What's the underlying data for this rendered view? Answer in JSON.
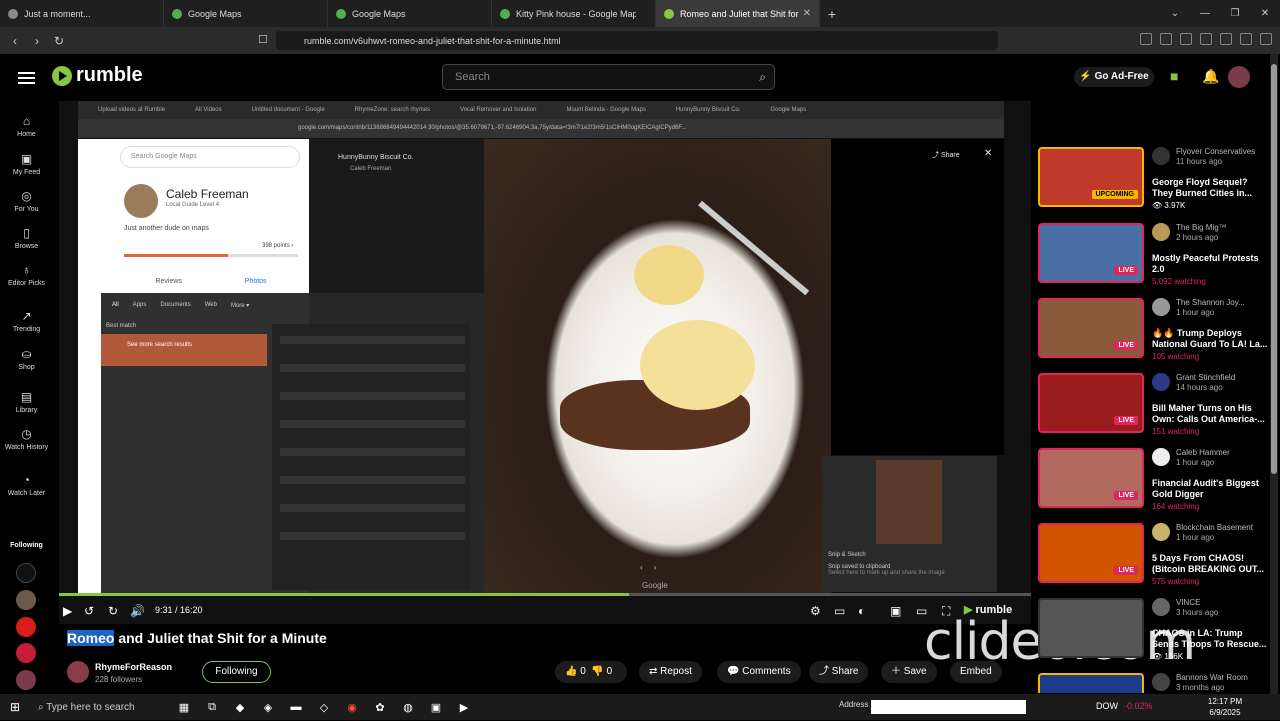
{
  "browser": {
    "tabs": [
      {
        "label": "Just a moment...",
        "color": "#888"
      },
      {
        "label": "Google Maps",
        "color": "#4caf50"
      },
      {
        "label": "Google Maps",
        "color": "#4caf50"
      },
      {
        "label": "Kitty Pink house - Google Maps",
        "color": "#4caf50"
      },
      {
        "label": "Romeo and Juliet that Shit for a",
        "color": "#85c742"
      }
    ],
    "url": "rumble.com/v6uhwvt-romeo-and-juliet-that-shit-for-a-minute.html"
  },
  "header": {
    "logo": "rumble",
    "search_placeholder": "Search",
    "go_ad_free": "Go Ad-Free"
  },
  "sidebar": {
    "items": [
      "Home",
      "My Feed",
      "For You",
      "Browse",
      "Editor Picks",
      "Trending",
      "Shop",
      "Library",
      "Watch History",
      "Watch Later"
    ],
    "following_label": "Following"
  },
  "video_frame": {
    "tabs": [
      "Upload videos at Rumble",
      "All Videos",
      "Untitled document - Google",
      "RhymeZone: search rhymes",
      "Vocal Remover and Isolation",
      "Mount Belinda - Google Maps",
      "HunnyBunny Biscuit Co.",
      "Google Maps"
    ],
    "url": "google.com/maps/contrib/113886849494442014 30/photos/@35.6079671,-97.6246904,3a,75y/data=!3m7!1e2!3m5!1sCIHM0ogKEICAgICPyd6F...",
    "maps_search": "Search Google Maps",
    "profile_name": "Caleb Freeman",
    "profile_sub": "Local Guide Level 4",
    "bio": "Just another dude on maps",
    "points": "398 points ›",
    "tab_reviews": "Reviews",
    "tab_photos": "Photos",
    "place_title": "HunnyBunny Biscuit Co.",
    "place_sub": "Caleb Freeman",
    "share": "Share",
    "winsearch_tabs": [
      "All",
      "Apps",
      "Documents",
      "Web",
      "More ▾"
    ],
    "best_match": "Best match",
    "see_more": "See more search results",
    "snip_title": "Snip & Sketch",
    "snip_msg": "Snip saved to clipboard",
    "snip_sub": "Select here to mark up and share the image",
    "google": "Google"
  },
  "player": {
    "time": "9:31 / 16:20",
    "progress": 0.586,
    "brand": "rumble"
  },
  "video": {
    "title_highlight": "Romeo",
    "title_rest": " and Juliet that Shit for a Minute",
    "channel": "RhymeForReason",
    "followers": "228 followers",
    "follow_btn": "Following",
    "likes": "0",
    "dislikes": "0",
    "repost": "Repost",
    "comments": "Comments",
    "share": "Share",
    "save": "Save",
    "embed": "Embed"
  },
  "watermark": "clideo.com",
  "related": [
    {
      "channel": "Flyover Conservatives",
      "ago": "11 hours ago",
      "title": "George Floyd Sequel? They Burned Cities in...",
      "meta": "3.97K",
      "live": false,
      "badge": "UPCOMING",
      "thumb": "#c0392b"
    },
    {
      "channel": "The Big Mig™",
      "ago": "2 hours ago",
      "title": "Mostly Peaceful Protests 2.0",
      "meta": "5,092 watching",
      "live": true,
      "badge": "LIVE",
      "thumb": "#4a6fa5"
    },
    {
      "channel": "The Shannon Joy...",
      "ago": "1 hour ago",
      "title": "🔥🔥 Trump Deploys National Guard To LA! La...",
      "meta": "105 watching",
      "live": true,
      "badge": "LIVE",
      "thumb": "#8a5a3a"
    },
    {
      "channel": "Grant Stinchfield",
      "ago": "14 hours ago",
      "title": "Bill Maher Turns on His Own: Calls Out America-...",
      "meta": "151 watching",
      "live": true,
      "badge": "LIVE",
      "thumb": "#9b1c1c"
    },
    {
      "channel": "Caleb Hammer",
      "ago": "1 hour ago",
      "title": "Financial Audit's Biggest Gold Digger",
      "meta": "164 watching",
      "live": true,
      "badge": "LIVE",
      "thumb": "#b36a5e"
    },
    {
      "channel": "Blockchain Basement",
      "ago": "1 hour ago",
      "title": "5 Days From CHAOS! (Bitcoin BREAKING OUT...",
      "meta": "575 watching",
      "live": true,
      "badge": "LIVE",
      "thumb": "#d35400"
    },
    {
      "channel": "VINCE",
      "ago": "3 hours ago",
      "title": "CHAOS in LA: Trump Sends Troops To Rescue...",
      "meta": "156K",
      "live": false,
      "badge": "",
      "thumb": "#555"
    },
    {
      "channel": "Bannons War Room",
      "ago": "3 months ago",
      "title": "",
      "meta": "",
      "live": false,
      "badge": "",
      "thumb": "#1d3c8a"
    }
  ],
  "taskbar": {
    "search": "Type here to search",
    "address_label": "Address",
    "dow": "DOW",
    "dow_change": "-0.02%",
    "time": "12:17 PM",
    "date": "6/9/2025"
  }
}
